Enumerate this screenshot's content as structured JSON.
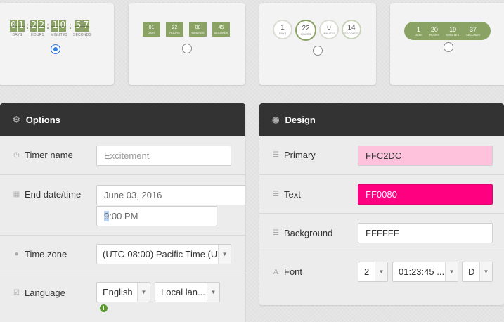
{
  "cards": [
    {
      "selected": true,
      "units": [
        {
          "digits": [
            "0",
            "1"
          ],
          "label": "DAYS"
        },
        {
          "digits": [
            "2",
            "2"
          ],
          "label": "HOURS"
        },
        {
          "digits": [
            "1",
            "0"
          ],
          "label": "MINUTES"
        },
        {
          "digits": [
            "5",
            "7"
          ],
          "label": "SECONDS"
        }
      ]
    },
    {
      "selected": false,
      "units": [
        {
          "value": "01",
          "label": "DAYS"
        },
        {
          "value": "22",
          "label": "HOURS"
        },
        {
          "value": "08",
          "label": "MINUTES"
        },
        {
          "value": "45",
          "label": "SECONDS"
        }
      ]
    },
    {
      "selected": false,
      "units": [
        {
          "value": "1",
          "label": "DAYS"
        },
        {
          "value": "22",
          "label": "HOURS"
        },
        {
          "value": "0",
          "label": "MINUTES"
        },
        {
          "value": "14",
          "label": "SECONDS"
        }
      ]
    },
    {
      "selected": false,
      "units": [
        {
          "value": "1",
          "label": "DAYS"
        },
        {
          "value": "20",
          "label": "HOURS"
        },
        {
          "value": "19",
          "label": "MINUTES"
        },
        {
          "value": "37",
          "label": "SECONDS"
        }
      ]
    }
  ],
  "options": {
    "title": "Options",
    "timer_name": {
      "label": "Timer name",
      "placeholder": "Excitement"
    },
    "end_datetime": {
      "label": "End date/time",
      "date": "June 03, 2016",
      "time_first": "9",
      "time_rest": ":00 PM"
    },
    "time_zone": {
      "label": "Time zone",
      "value": "(UTC-08:00) Pacific Time (U..."
    },
    "language": {
      "label": "Language",
      "value": "English",
      "local": "Local lan...",
      "info_icon": "info-icon"
    }
  },
  "design": {
    "title": "Design",
    "primary": {
      "label": "Primary",
      "value": "FFC2DC",
      "color": "#FFC2DC"
    },
    "text": {
      "label": "Text",
      "value": "FF0080",
      "color": "#FF0080"
    },
    "background": {
      "label": "Background",
      "value": "FFFFFF",
      "color": "#FFFFFF"
    },
    "font": {
      "label": "Font",
      "size": "2",
      "format": "01:23:45 ...",
      "style": "D"
    }
  },
  "colors": {
    "accent_green": "#8aa263",
    "header_bg": "#333333",
    "radio_blue": "#2f7de1"
  }
}
